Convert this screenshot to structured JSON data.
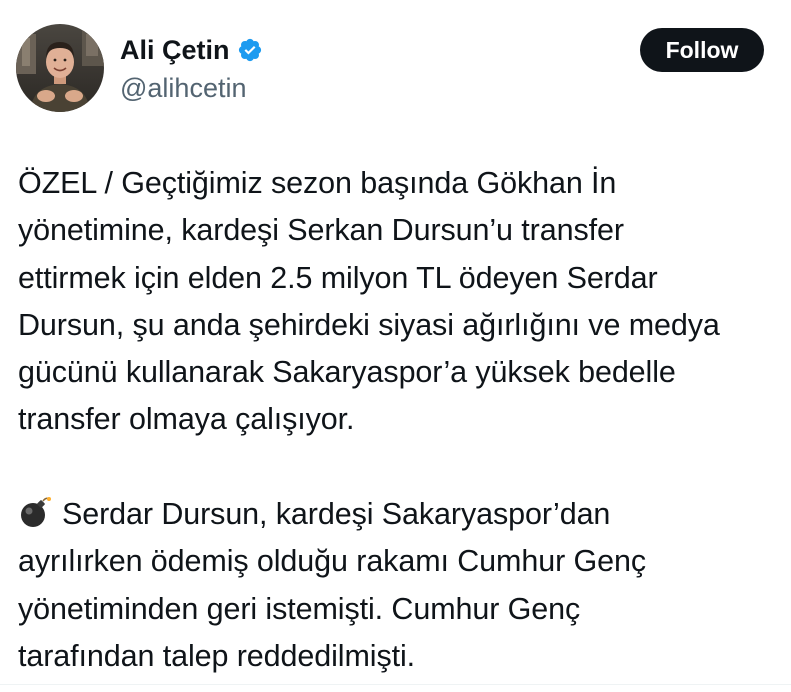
{
  "author": {
    "display_name": "Ali Çetin",
    "handle": "@alihcetin",
    "verified": true,
    "avatar_icon": "user-avatar"
  },
  "follow_button": {
    "label": "Follow"
  },
  "tweet": {
    "lines": [
      "ÖZEL /  Geçtiğimiz sezon başında Gökhan İn",
      "yönetimine, kardeşi Serkan Dursun’u transfer",
      "ettirmek için elden 2.5 milyon TL ödeyen Serdar",
      "Dursun, şu anda şehirdeki siyasi ağırlığını ve medya",
      "gücünü kullanarak Sakaryaspor’a yüksek bedelle",
      "transfer olmaya çalışıyor."
    ],
    "lines2_emoji": "bomb-emoji",
    "lines2": [
      "Serdar Dursun, kardeşi Sakaryaspor’dan",
      "ayrılırken ödemiş olduğu rakamı Cumhur Genç",
      "yönetiminden geri istemişti. Cumhur Genç",
      "tarafından talep reddedilmişti."
    ]
  },
  "colors": {
    "text_primary": "#0f1419",
    "text_secondary": "#536471",
    "verified_blue": "#1d9bf0",
    "button_bg": "#0f1419",
    "button_text": "#ffffff"
  }
}
